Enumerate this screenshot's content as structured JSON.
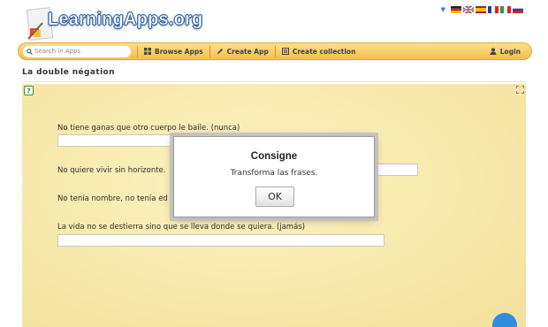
{
  "header": {
    "logo_text": "LearningApps.org",
    "languages": [
      "de",
      "en",
      "es",
      "fr",
      "it",
      "ru"
    ]
  },
  "nav": {
    "search_placeholder": "Search in Apps",
    "browse_label": "Browse Apps",
    "create_label": "Create App",
    "collection_label": "Create collection",
    "login_label": "Login"
  },
  "page": {
    "title": "La double négation"
  },
  "exercise": {
    "questions": [
      {
        "text": "No tiene ganas que otro cuerpo le baile. (nunca)",
        "answer": ""
      },
      {
        "text": "No quiere vivir sin horizonte.",
        "answer": ""
      },
      {
        "text": "No tenía nombre, no tenía ed",
        "answer": ""
      },
      {
        "text": "La vida no se destierra sino que se lleva donde se quiera. (jamás)",
        "answer": ""
      }
    ]
  },
  "dialog": {
    "title": "Consigne",
    "text": "Transforma las frases.",
    "ok_label": "OK"
  },
  "colors": {
    "accent_blue": "#2f8ee0",
    "nav_yellow": "#f3bf45",
    "paper": "#f8ebb0"
  }
}
